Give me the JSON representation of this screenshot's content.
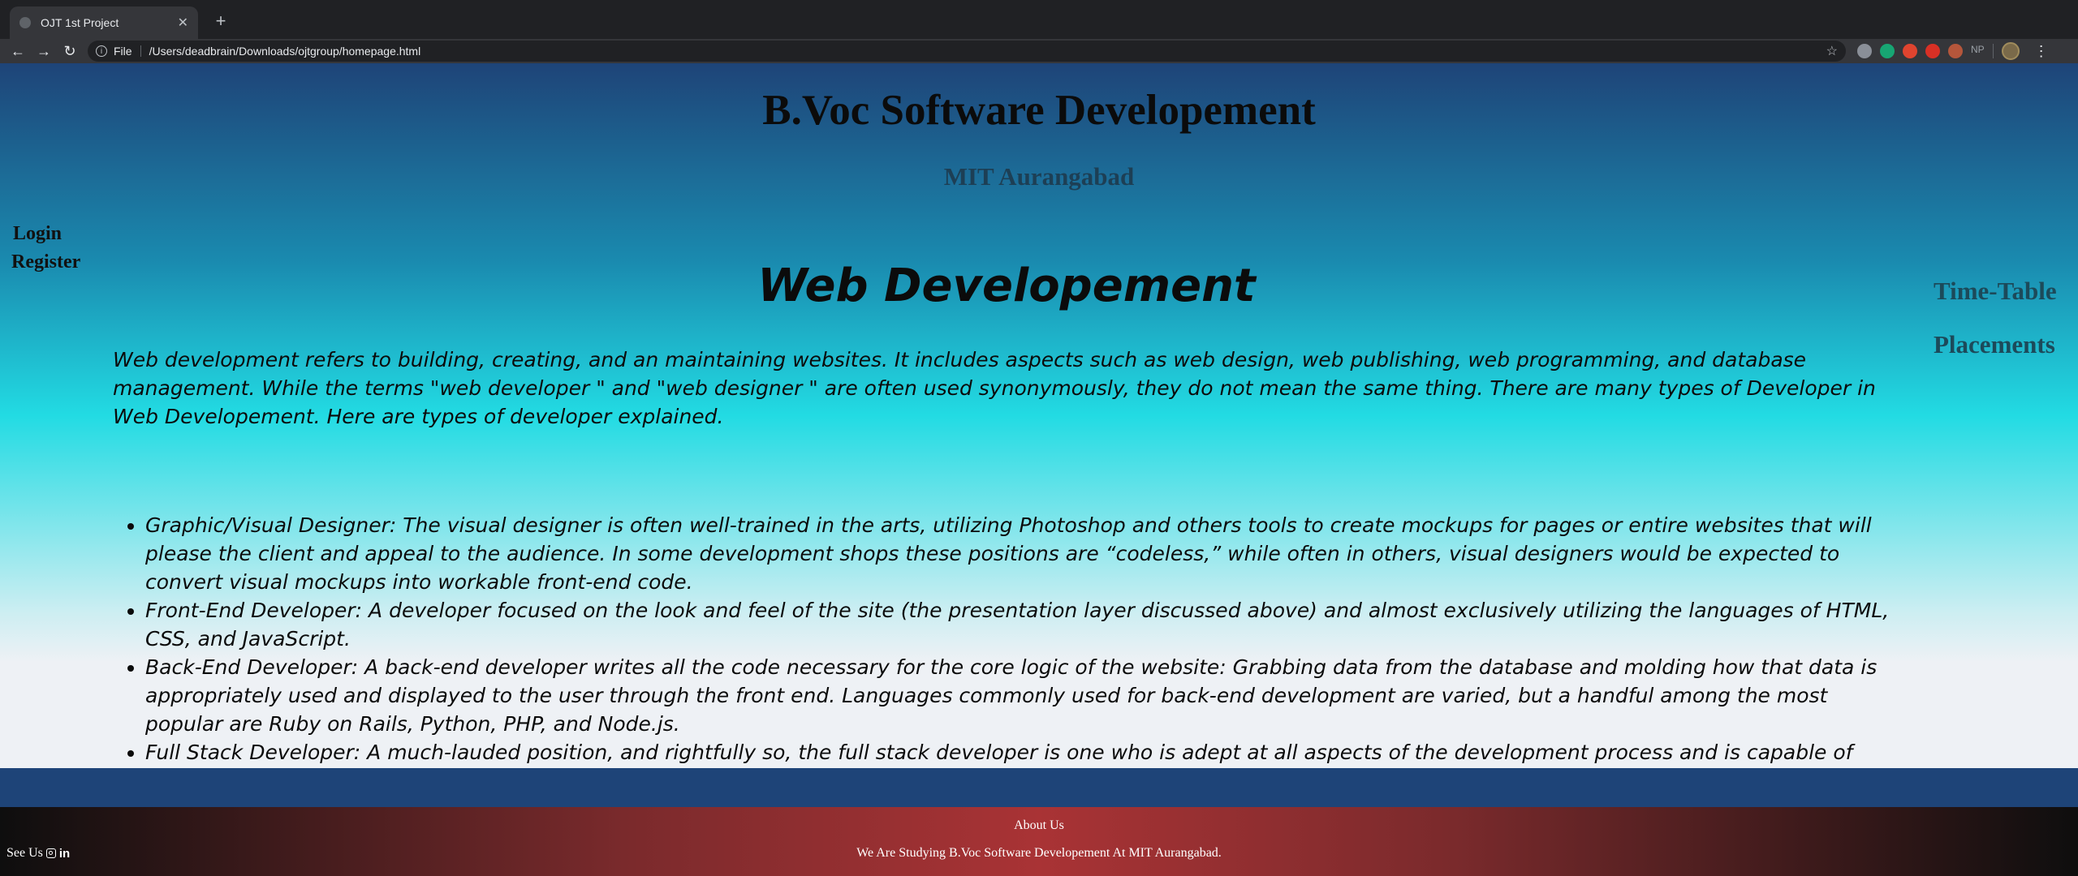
{
  "browser": {
    "tab_title": "OJT 1st Project",
    "tab_close": "✕",
    "new_tab": "+",
    "back": "←",
    "forward": "→",
    "reload": "↻",
    "scheme_label": "File",
    "url": "/Users/deadbrain/Downloads/ojtgroup/homepage.html",
    "ext_np_label": "NP",
    "menu": "⋮",
    "colors": {
      "chrome_bg": "#202124",
      "tab_bg": "#35363a"
    }
  },
  "header": {
    "title": "B.Voc Software Developement",
    "subtitle": "MIT Aurangabad"
  },
  "left_nav": {
    "login": "Login",
    "register": "Register"
  },
  "right_nav": {
    "timetable": "Time-Table",
    "placements": "Placements"
  },
  "content": {
    "title": "Web Developement",
    "intro": "Web development refers to building, creating, and an maintaining websites. It includes aspects such as web design, web publishing, web programming, and database management. While the terms \"web developer \" and \"web designer \" are often used synonymously, they do not mean the same thing. There are many types of Developer in Web Developement. Here are types of developer explained.",
    "types": [
      "Graphic/Visual Designer: The visual designer is often well-trained in the arts, utilizing Photoshop and others tools to create mockups for pages or entire websites that will please the client and appeal to the audience. In some development shops these positions are “codeless,” while often in others, visual designers would be expected to convert visual mockups into workable front-end code.",
      "Front-End Developer: A developer focused on the look and feel of the site (the presentation layer discussed above) and almost exclusively utilizing the languages of HTML, CSS, and JavaScript.",
      "Back-End Developer: A back-end developer writes all the code necessary for the core logic of the website: Grabbing data from the database and molding how that data is appropriately used and displayed to the user through the front end. Languages commonly used for back-end development are varied, but a handful among the most popular are Ruby on Rails, Python, PHP, and Node.js.",
      "Full Stack Developer: A much-lauded position, and rightfully so, the full stack developer is one who is adept at all aspects of the development process and is capable of contributing code and functional solutions every step of the way, from planning and design to both front- and back-end coding."
    ]
  },
  "footer": {
    "about_title": "About Us",
    "about_text": "We Are Studying B.Voc Software Developement At MIT Aurangabad.",
    "see_us": "See Us",
    "linkedin": "in"
  },
  "colors": {
    "band": "#1e4478",
    "footer_center": "#a93335"
  }
}
